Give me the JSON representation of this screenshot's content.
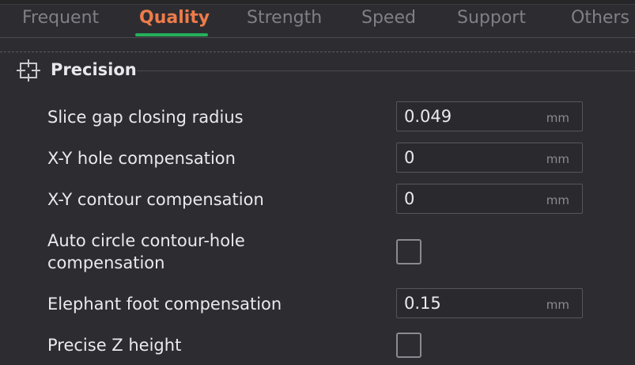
{
  "tabs": [
    {
      "label": "Frequent",
      "active": false
    },
    {
      "label": "Quality",
      "active": true
    },
    {
      "label": "Strength",
      "active": false
    },
    {
      "label": "Speed",
      "active": false
    },
    {
      "label": "Support",
      "active": false
    },
    {
      "label": "Others",
      "active": false
    }
  ],
  "colors": {
    "active_tab": "#ee7b4a",
    "tab_underline": "#25b05a",
    "background": "#2d2d31"
  },
  "section": {
    "icon": "precision-crosshair-icon",
    "title": "Precision"
  },
  "settings": [
    {
      "label": "Slice gap closing radius",
      "type": "number",
      "value": "0.049",
      "unit": "mm"
    },
    {
      "label": "X-Y hole compensation",
      "type": "number",
      "value": "0",
      "unit": "mm"
    },
    {
      "label": "X-Y contour compensation",
      "type": "number",
      "value": "0",
      "unit": "mm"
    },
    {
      "label": "Auto circle contour-hole compensation",
      "type": "checkbox",
      "checked": false
    },
    {
      "label": "Elephant foot compensation",
      "type": "number",
      "value": "0.15",
      "unit": "mm"
    },
    {
      "label": "Precise Z height",
      "type": "checkbox",
      "checked": false
    }
  ]
}
